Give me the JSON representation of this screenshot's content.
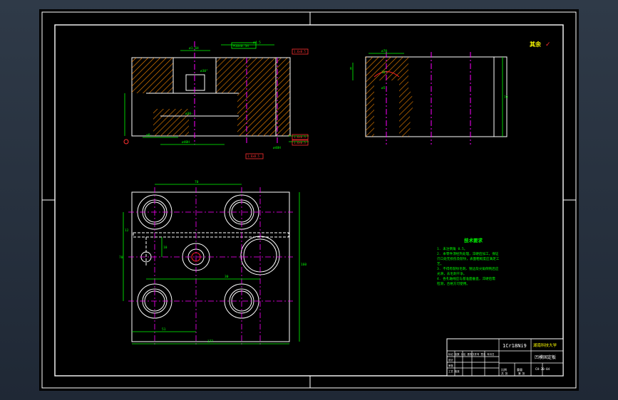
{
  "app": {
    "viewport_label": "CAD drawing viewport"
  },
  "colors": {
    "background": "#000000",
    "frame": "#ffffff",
    "section_hatch": "#ff8c00",
    "centerline": "#ff00ff",
    "dimension": "#00ff00",
    "note_text": "#00ff00",
    "datum_tag": "#ff3030",
    "bore_red": "#ff2020"
  },
  "check_mark": {
    "text": "其余",
    "symbol": "✓"
  },
  "section_view_a": {
    "dims": [
      "M10x0.5H",
      "ø1.6H",
      "ø4.5",
      "ø30°",
      "ø20-",
      "ø8-",
      "ø40H",
      "ø48H"
    ],
    "datum_tags": [
      "1.6x0.5",
      "1.6x0.5",
      "1.6x0.5",
      "1.6x0.5"
    ]
  },
  "section_view_b": {
    "dims": [
      "ø70",
      "R",
      "30°",
      "ø5",
      "70"
    ]
  },
  "plan_view": {
    "dims": {
      "top": "70",
      "left_height": "70",
      "right_height": "160",
      "offset": "12",
      "mid": "30",
      "center_v": "10",
      "bottom_left": "51",
      "bottom_total": "177"
    }
  },
  "tech_requirements": {
    "title": "技术要求",
    "items": [
      "1. 未注倒角 0.5。",
      "2. 本零件须经热处理，淬硬后加工，保证",
      "   刃口处无损伤及裂纹，表面粗糙度应满足工",
      "   艺。",
      "3. 不得有裂纹毛刺、锐边及尖角倒钝后应",
      "   光滑，去毛刺干净。",
      "4. 各孔轴线应与基准面垂直，淬硬后需",
      "   检测，合格方可使用。"
    ]
  },
  "title_block": {
    "material": "1Cr18Ni9",
    "school": "湖南科技大学",
    "part_name": "凹模固定板",
    "drawing_no": "CH-20-04",
    "scale_label": "比例",
    "sheet_label": "重量",
    "rows": [
      "标记 处数 分区 更改文件号 签名 年月日",
      "设计",
      "审核",
      "工艺 批准"
    ],
    "bottom": [
      "共 张",
      "第 张"
    ]
  }
}
